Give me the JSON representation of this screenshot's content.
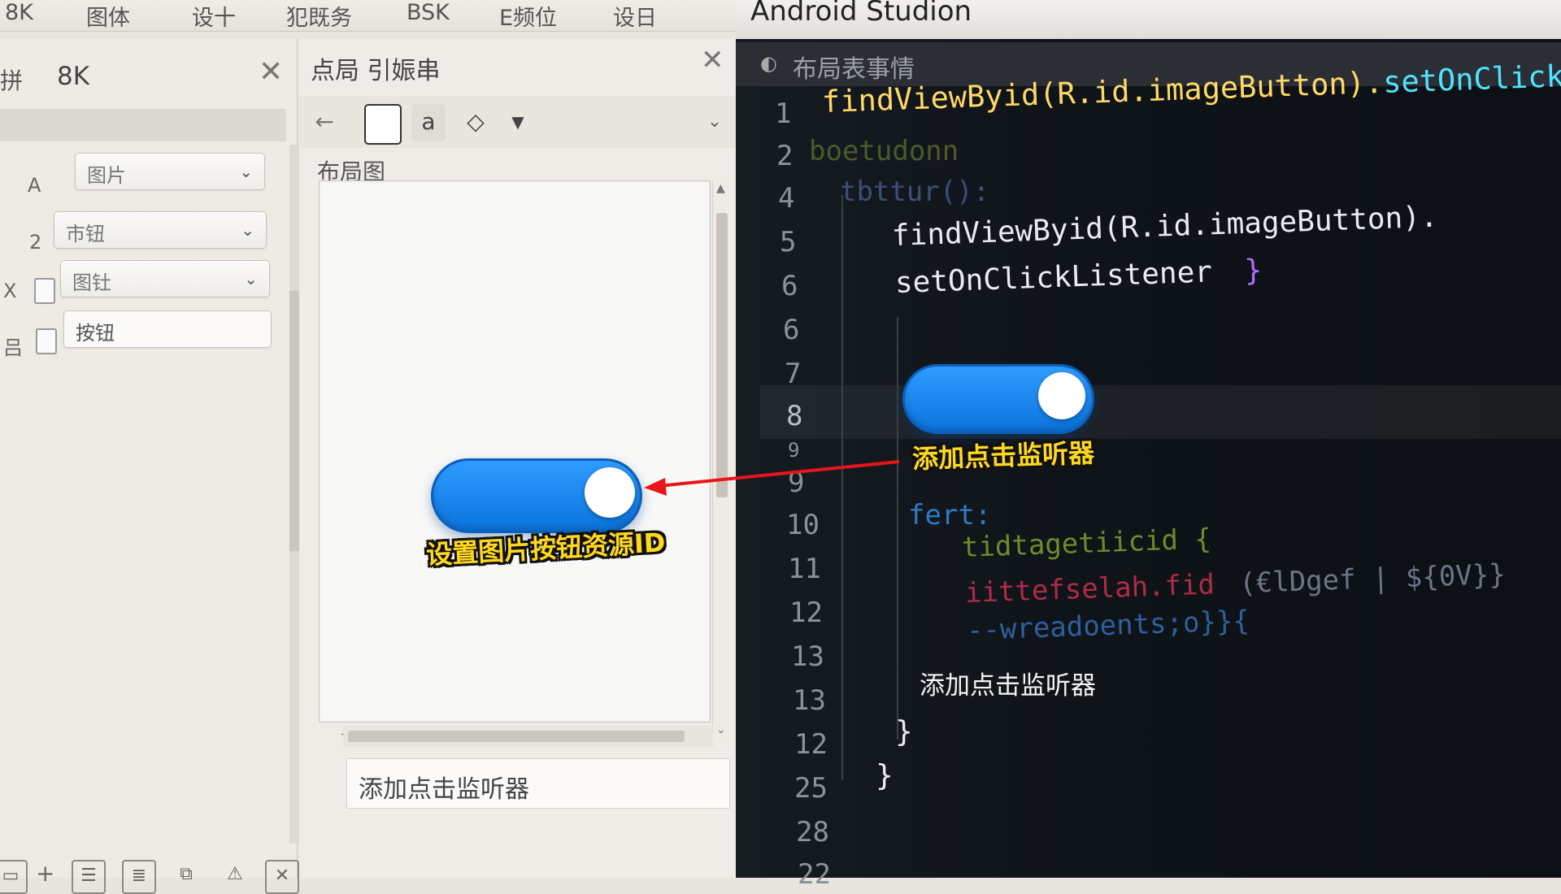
{
  "menubar": {
    "items": [
      "8K",
      "图体",
      "设十",
      "犯既务",
      "BSK",
      "E频位",
      "设日"
    ]
  },
  "left_panel": {
    "left_fragment": "拼",
    "title": "8K",
    "rows": [
      {
        "label": "A",
        "value": "图片"
      },
      {
        "label": "2",
        "value": "市钮"
      },
      {
        "label": "X",
        "value": "图钍"
      },
      {
        "label": "吕",
        "value": "按钮"
      }
    ]
  },
  "mid_panel": {
    "title": "点局 引娠串",
    "canvas_label": "布局图",
    "listener_box_text": "添加点击监听器",
    "toggle_caption": "设置图片按钮资源ID"
  },
  "code_editor": {
    "window_title": "Android Studion",
    "tab_label": "布局表事情",
    "line_numbers": [
      "1",
      "2",
      "4",
      "5",
      "6",
      "6",
      "7",
      "8",
      "9",
      "9",
      "10",
      "11",
      "12",
      "13",
      "13",
      "12",
      "25",
      "28",
      "22"
    ],
    "lines": {
      "l1_a": "findViewByid(R.id.imageButton).",
      "l1_b": "setOnClickLi",
      "l2": "boetudonn",
      "l4": "tbttur():",
      "l5": "findViewByid(R.id.imageButton).",
      "l6": "setOnClickListener",
      "l6_brace": "}",
      "l10": "fert:",
      "l11": "tidtagetiicid {",
      "l12_a": "iittefselah.fid",
      "l12_b": "(€lDgef | ${0V}}",
      "l13": "--wreadoents;o}}{",
      "l13b": "添加点击监听器",
      "close_inner": "}",
      "close_outer": "}"
    },
    "toggle_caption": "添加点击监听器"
  },
  "colors": {
    "toggle_blue": "#1a86f0",
    "arrow_red": "#e8161b",
    "label_yellow": "#ffd81f",
    "code_cyan": "#4fe3ff",
    "code_yellow": "#ffd866",
    "code_white": "#e8ecf1"
  },
  "icons": [
    "close-icon",
    "back-arrow-icon",
    "square-tool-icon",
    "text-tool-icon",
    "eraser-icon",
    "chevron-down-icon",
    "plus-icon"
  ]
}
